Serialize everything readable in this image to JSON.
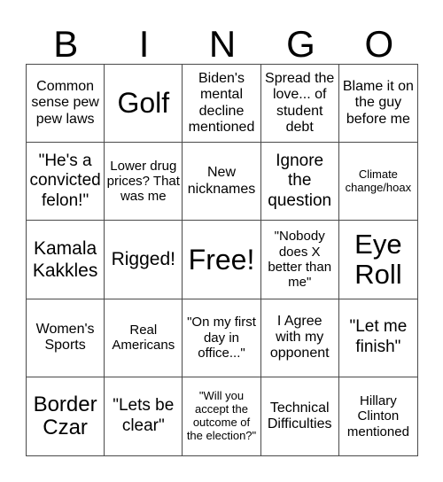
{
  "header": [
    "B",
    "I",
    "N",
    "G",
    "O"
  ],
  "cells": [
    "Common sense pew pew laws",
    "Golf",
    "Biden's mental decline mentioned",
    "Spread the love... of student debt",
    "Blame it on the guy before me",
    "\"He's a convicted felon!\"",
    "Lower drug prices? That was me",
    "New nicknames",
    "Ignore the question",
    "Climate change/hoax",
    "Kamala Kakkles",
    "Rigged!",
    "Free!",
    "\"Nobody does X better than me\"",
    "Eye Roll",
    "Women's Sports",
    "Real Americans",
    "\"On my first day in office...\"",
    "I Agree with my opponent",
    "\"Let me finish\"",
    "Border Czar",
    "\"Lets be clear\"",
    "\"Will you accept the outcome of the election?\"",
    "Technical Difficulties",
    "Hillary Clinton mentioned"
  ]
}
